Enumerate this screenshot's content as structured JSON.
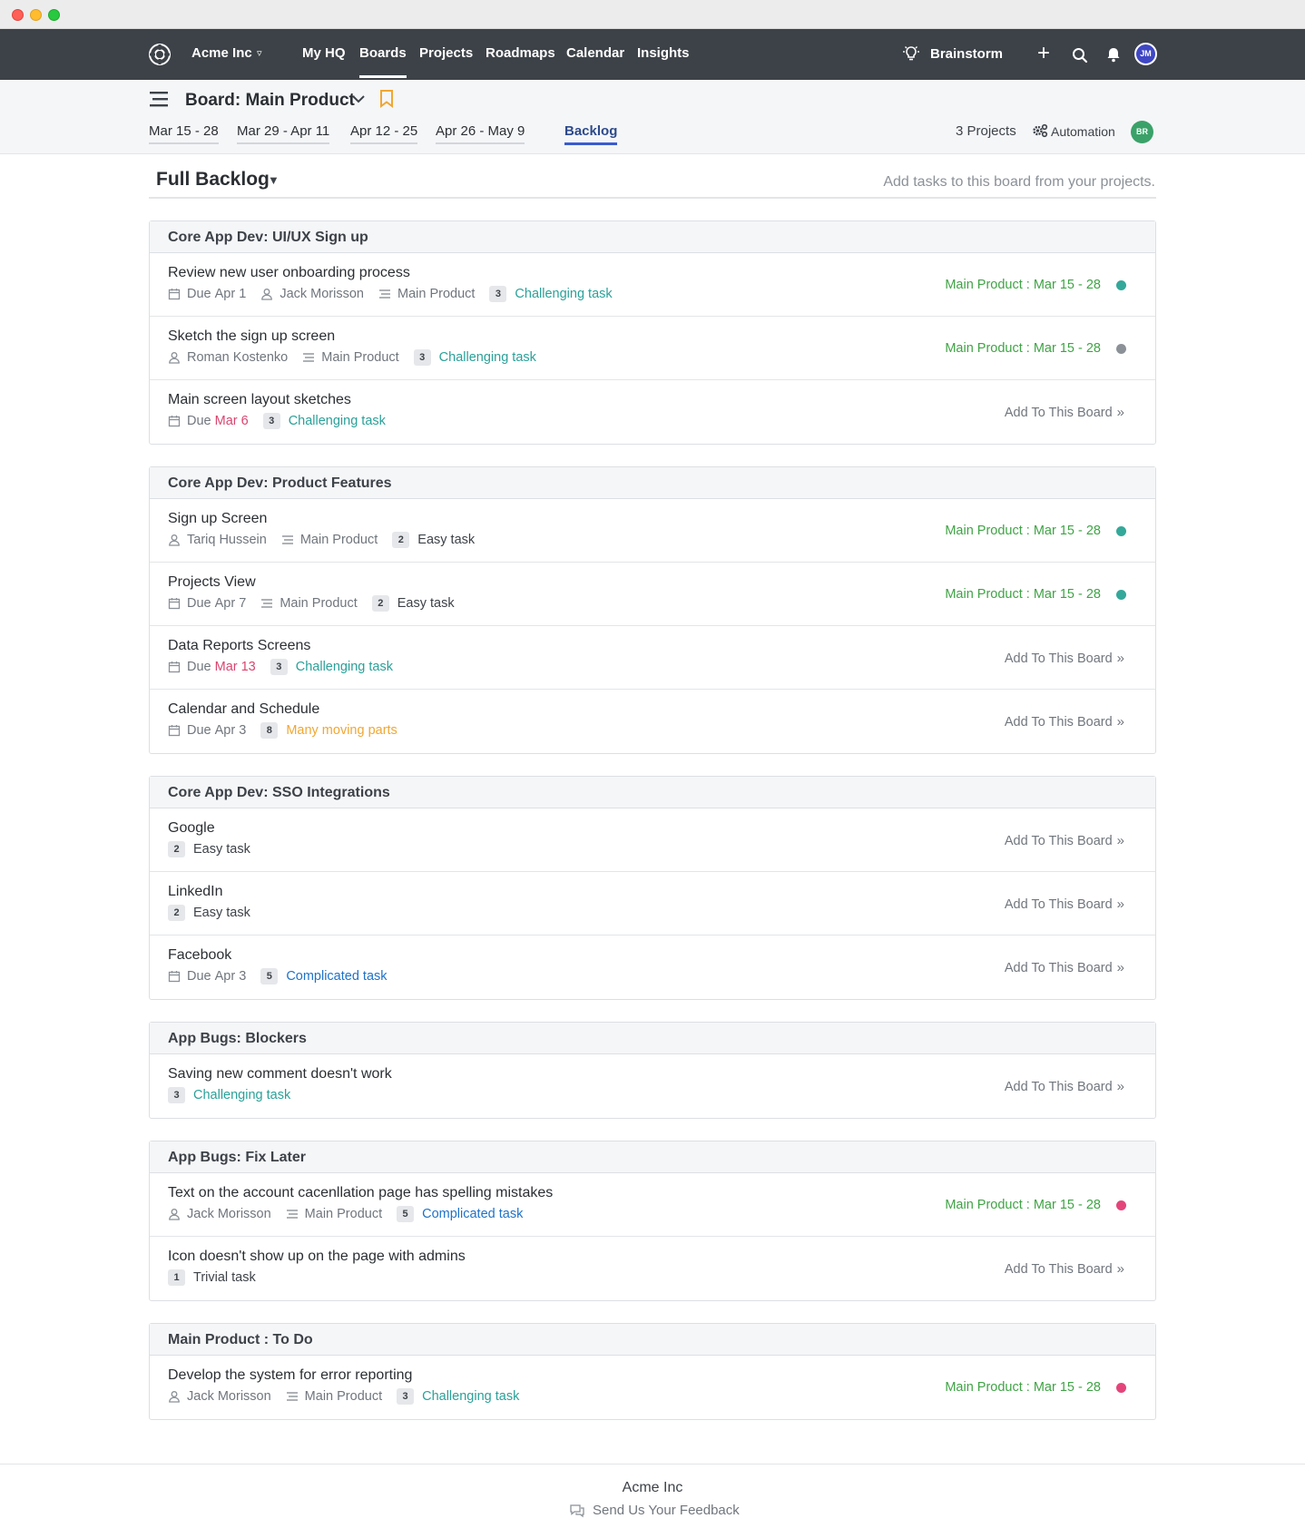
{
  "nav": {
    "org": "Acme Inc",
    "links": [
      "My HQ",
      "Boards",
      "Projects",
      "Roadmaps",
      "Calendar",
      "Insights"
    ],
    "active": "Boards",
    "brainstorm": "Brainstorm",
    "avatar": "JM"
  },
  "board": {
    "title": "Board: Main Product",
    "periods": [
      "Mar 15 - 28",
      "Mar 29 - Apr 11",
      "Apr 12 - 25",
      "Apr 26 - May 9"
    ],
    "backlog_tab": "Backlog",
    "projects_count": "3 Projects",
    "automation": "Automation",
    "avatar": "BR"
  },
  "backlog": {
    "title": "Full Backlog",
    "hint": "Add tasks to this board from your projects."
  },
  "add_label": "Add To This Board",
  "groups": [
    {
      "title": "Core App Dev: UI/UX Sign up",
      "tasks": [
        {
          "title": "Review new user onboarding process",
          "due_prefix": "Due",
          "due": "Apr 1",
          "assignee": "Jack Morisson",
          "project": "Main Product",
          "points": "3",
          "difficulty": "Challenging task",
          "sprint": "Main Product : Mar 15 - 28"
        },
        {
          "title": "Sketch the sign up screen",
          "assignee": "Roman Kostenko",
          "project": "Main Product",
          "points": "3",
          "difficulty": "Challenging task",
          "sprint": "Main Product : Mar 15 - 28"
        },
        {
          "title": "Main screen layout sketches",
          "due_prefix": "Due",
          "due": "Mar 6",
          "points": "3",
          "difficulty": "Challenging task"
        }
      ]
    },
    {
      "title": "Core App Dev: Product Features",
      "tasks": [
        {
          "title": "Sign up Screen",
          "assignee": "Tariq Hussein",
          "project": "Main Product",
          "points": "2",
          "difficulty": "Easy task",
          "sprint": "Main Product : Mar 15 - 28"
        },
        {
          "title": "Projects View",
          "due_prefix": "Due",
          "due": "Apr 7",
          "project": "Main Product",
          "points": "2",
          "difficulty": "Easy task",
          "sprint": "Main Product : Mar 15 - 28"
        },
        {
          "title": "Data Reports Screens",
          "due_prefix": "Due",
          "due": "Mar 13",
          "points": "3",
          "difficulty": "Challenging task"
        },
        {
          "title": "Calendar and Schedule",
          "due_prefix": "Due",
          "due": "Apr 3",
          "points": "8",
          "difficulty": "Many moving parts"
        }
      ]
    },
    {
      "title": "Core App Dev: SSO Integrations",
      "tasks": [
        {
          "title": "Google",
          "points": "2",
          "difficulty": "Easy task"
        },
        {
          "title": "LinkedIn",
          "points": "2",
          "difficulty": "Easy task"
        },
        {
          "title": "Facebook",
          "due_prefix": "Due",
          "due": "Apr 3",
          "points": "5",
          "difficulty": "Complicated task"
        }
      ]
    },
    {
      "title": "App Bugs: Blockers",
      "tasks": [
        {
          "title": "Saving new comment doesn't work",
          "points": "3",
          "difficulty": "Challenging task"
        }
      ]
    },
    {
      "title": "App Bugs: Fix Later",
      "tasks": [
        {
          "title": "Text on the account cacenllation page has spelling mistakes",
          "assignee": "Jack Morisson",
          "project": "Main Product",
          "points": "5",
          "difficulty": "Complicated task",
          "sprint": "Main Product : Mar 15 - 28"
        },
        {
          "title": "Icon doesn't show up on the page with admins",
          "points": "1",
          "difficulty": "Trivial task"
        }
      ]
    },
    {
      "title": "Main Product : To Do",
      "tasks": [
        {
          "title": "Develop the system for error reporting",
          "assignee": "Jack Morisson",
          "project": "Main Product",
          "points": "3",
          "difficulty": "Challenging task",
          "sprint": "Main Product : Mar 15 - 28"
        }
      ]
    }
  ],
  "footer": {
    "org": "Acme Inc",
    "feedback": "Send Us Your Feedback"
  },
  "icons": [
    "logo-icon",
    "caret-down-icon",
    "lightbulb-icon",
    "plus-icon",
    "search-icon",
    "bell-icon",
    "board-list-icon",
    "chevron-down-icon",
    "bookmark-icon",
    "gear-icon",
    "calendar-icon",
    "user-icon",
    "project-list-icon",
    "double-chevron-right-icon",
    "chat-bubble-icon"
  ],
  "colors": {
    "nav_bg": "#3d4248",
    "sprint_green": "#3fa445",
    "difficulty_teal": "#2aa199",
    "difficulty_blue": "#1f72c8",
    "difficulty_orange": "#f0a733",
    "due_overdue": "#d9466f",
    "status_teal": "#34a89a",
    "status_grey": "#8c9197",
    "status_pink": "#e3457a",
    "avatar_jm": "#3f47c4",
    "avatar_br": "#3aa269"
  }
}
